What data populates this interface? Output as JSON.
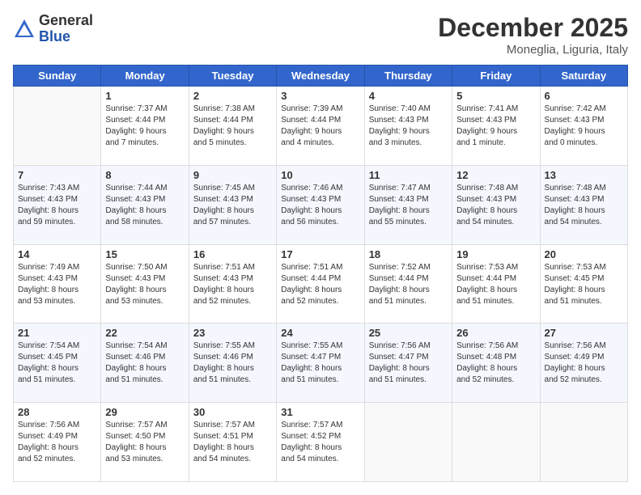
{
  "logo": {
    "general": "General",
    "blue": "Blue"
  },
  "title": "December 2025",
  "subtitle": "Moneglia, Liguria, Italy",
  "weekdays": [
    "Sunday",
    "Monday",
    "Tuesday",
    "Wednesday",
    "Thursday",
    "Friday",
    "Saturday"
  ],
  "weeks": [
    [
      {
        "day": "",
        "info": ""
      },
      {
        "day": "1",
        "info": "Sunrise: 7:37 AM\nSunset: 4:44 PM\nDaylight: 9 hours\nand 7 minutes."
      },
      {
        "day": "2",
        "info": "Sunrise: 7:38 AM\nSunset: 4:44 PM\nDaylight: 9 hours\nand 5 minutes."
      },
      {
        "day": "3",
        "info": "Sunrise: 7:39 AM\nSunset: 4:44 PM\nDaylight: 9 hours\nand 4 minutes."
      },
      {
        "day": "4",
        "info": "Sunrise: 7:40 AM\nSunset: 4:43 PM\nDaylight: 9 hours\nand 3 minutes."
      },
      {
        "day": "5",
        "info": "Sunrise: 7:41 AM\nSunset: 4:43 PM\nDaylight: 9 hours\nand 1 minute."
      },
      {
        "day": "6",
        "info": "Sunrise: 7:42 AM\nSunset: 4:43 PM\nDaylight: 9 hours\nand 0 minutes."
      }
    ],
    [
      {
        "day": "7",
        "info": "Sunrise: 7:43 AM\nSunset: 4:43 PM\nDaylight: 8 hours\nand 59 minutes."
      },
      {
        "day": "8",
        "info": "Sunrise: 7:44 AM\nSunset: 4:43 PM\nDaylight: 8 hours\nand 58 minutes."
      },
      {
        "day": "9",
        "info": "Sunrise: 7:45 AM\nSunset: 4:43 PM\nDaylight: 8 hours\nand 57 minutes."
      },
      {
        "day": "10",
        "info": "Sunrise: 7:46 AM\nSunset: 4:43 PM\nDaylight: 8 hours\nand 56 minutes."
      },
      {
        "day": "11",
        "info": "Sunrise: 7:47 AM\nSunset: 4:43 PM\nDaylight: 8 hours\nand 55 minutes."
      },
      {
        "day": "12",
        "info": "Sunrise: 7:48 AM\nSunset: 4:43 PM\nDaylight: 8 hours\nand 54 minutes."
      },
      {
        "day": "13",
        "info": "Sunrise: 7:48 AM\nSunset: 4:43 PM\nDaylight: 8 hours\nand 54 minutes."
      }
    ],
    [
      {
        "day": "14",
        "info": "Sunrise: 7:49 AM\nSunset: 4:43 PM\nDaylight: 8 hours\nand 53 minutes."
      },
      {
        "day": "15",
        "info": "Sunrise: 7:50 AM\nSunset: 4:43 PM\nDaylight: 8 hours\nand 53 minutes."
      },
      {
        "day": "16",
        "info": "Sunrise: 7:51 AM\nSunset: 4:43 PM\nDaylight: 8 hours\nand 52 minutes."
      },
      {
        "day": "17",
        "info": "Sunrise: 7:51 AM\nSunset: 4:44 PM\nDaylight: 8 hours\nand 52 minutes."
      },
      {
        "day": "18",
        "info": "Sunrise: 7:52 AM\nSunset: 4:44 PM\nDaylight: 8 hours\nand 51 minutes."
      },
      {
        "day": "19",
        "info": "Sunrise: 7:53 AM\nSunset: 4:44 PM\nDaylight: 8 hours\nand 51 minutes."
      },
      {
        "day": "20",
        "info": "Sunrise: 7:53 AM\nSunset: 4:45 PM\nDaylight: 8 hours\nand 51 minutes."
      }
    ],
    [
      {
        "day": "21",
        "info": "Sunrise: 7:54 AM\nSunset: 4:45 PM\nDaylight: 8 hours\nand 51 minutes."
      },
      {
        "day": "22",
        "info": "Sunrise: 7:54 AM\nSunset: 4:46 PM\nDaylight: 8 hours\nand 51 minutes."
      },
      {
        "day": "23",
        "info": "Sunrise: 7:55 AM\nSunset: 4:46 PM\nDaylight: 8 hours\nand 51 minutes."
      },
      {
        "day": "24",
        "info": "Sunrise: 7:55 AM\nSunset: 4:47 PM\nDaylight: 8 hours\nand 51 minutes."
      },
      {
        "day": "25",
        "info": "Sunrise: 7:56 AM\nSunset: 4:47 PM\nDaylight: 8 hours\nand 51 minutes."
      },
      {
        "day": "26",
        "info": "Sunrise: 7:56 AM\nSunset: 4:48 PM\nDaylight: 8 hours\nand 52 minutes."
      },
      {
        "day": "27",
        "info": "Sunrise: 7:56 AM\nSunset: 4:49 PM\nDaylight: 8 hours\nand 52 minutes."
      }
    ],
    [
      {
        "day": "28",
        "info": "Sunrise: 7:56 AM\nSunset: 4:49 PM\nDaylight: 8 hours\nand 52 minutes."
      },
      {
        "day": "29",
        "info": "Sunrise: 7:57 AM\nSunset: 4:50 PM\nDaylight: 8 hours\nand 53 minutes."
      },
      {
        "day": "30",
        "info": "Sunrise: 7:57 AM\nSunset: 4:51 PM\nDaylight: 8 hours\nand 54 minutes."
      },
      {
        "day": "31",
        "info": "Sunrise: 7:57 AM\nSunset: 4:52 PM\nDaylight: 8 hours\nand 54 minutes."
      },
      {
        "day": "",
        "info": ""
      },
      {
        "day": "",
        "info": ""
      },
      {
        "day": "",
        "info": ""
      }
    ]
  ]
}
